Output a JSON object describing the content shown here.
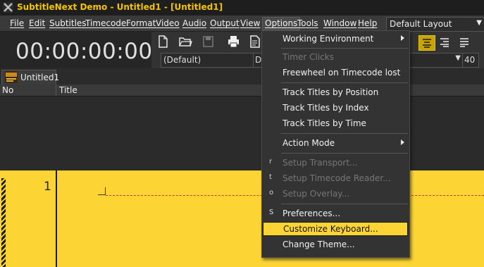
{
  "window": {
    "title": "SubtitleNext Demo - Untitled1 - [Untitled1]",
    "title_color": "#f2c400"
  },
  "menubar": {
    "items": [
      "File",
      "Edit",
      "Subtitles",
      "Timecode",
      "Format",
      "Video",
      "Audio",
      "Output",
      "View",
      "Options",
      "Tools",
      "Window",
      "Help"
    ],
    "active": "Options",
    "layout_select": "Default Layout"
  },
  "timecode": {
    "value": "00:00:00:00"
  },
  "toolbar": {
    "icons": [
      "new-file-icon",
      "open-folder-icon",
      "save-icon",
      "print-icon",
      "document-icon"
    ],
    "style_value": "(Default)",
    "style2_value": "D",
    "font_size_value": "40",
    "align_icons": [
      "align-center-icon",
      "align-right-icon",
      "align-justify-icon"
    ]
  },
  "tab": {
    "label": "Untitled1"
  },
  "columns": {
    "no": "No",
    "title": "Title"
  },
  "row": {
    "number": "1"
  },
  "options_menu": {
    "items": [
      {
        "label": "Working Environment",
        "key": "",
        "disabled": false,
        "submenu": true
      },
      {
        "label": "Timer Clicks",
        "key": "",
        "disabled": true,
        "submenu": false
      },
      {
        "label": "Freewheel on Timecode lost",
        "key": "",
        "disabled": false,
        "submenu": false
      },
      {
        "label": "Track Titles by Position",
        "key": "",
        "disabled": false,
        "submenu": false
      },
      {
        "label": "Track Titles by Index",
        "key": "",
        "disabled": false,
        "submenu": false
      },
      {
        "label": "Track Titles by Time",
        "key": "",
        "disabled": false,
        "submenu": false
      },
      {
        "label": "Action Mode",
        "key": "",
        "disabled": false,
        "submenu": true
      },
      {
        "label": "Setup Transport...",
        "key": "r",
        "disabled": true,
        "submenu": false
      },
      {
        "label": "Setup Timecode Reader...",
        "key": "t",
        "disabled": true,
        "submenu": false
      },
      {
        "label": "Setup Overlay...",
        "key": "o",
        "disabled": true,
        "submenu": false
      },
      {
        "label": "Preferences...",
        "key": "S",
        "disabled": false,
        "submenu": false
      },
      {
        "label": "Customize Keyboard...",
        "key": "",
        "disabled": false,
        "submenu": false,
        "highlighted": true
      },
      {
        "label": "Change Theme...",
        "key": "",
        "disabled": false,
        "submenu": false
      }
    ]
  },
  "colors": {
    "accent": "#fcd535",
    "background": "#2b2b2b",
    "menu_background": "#333333"
  }
}
